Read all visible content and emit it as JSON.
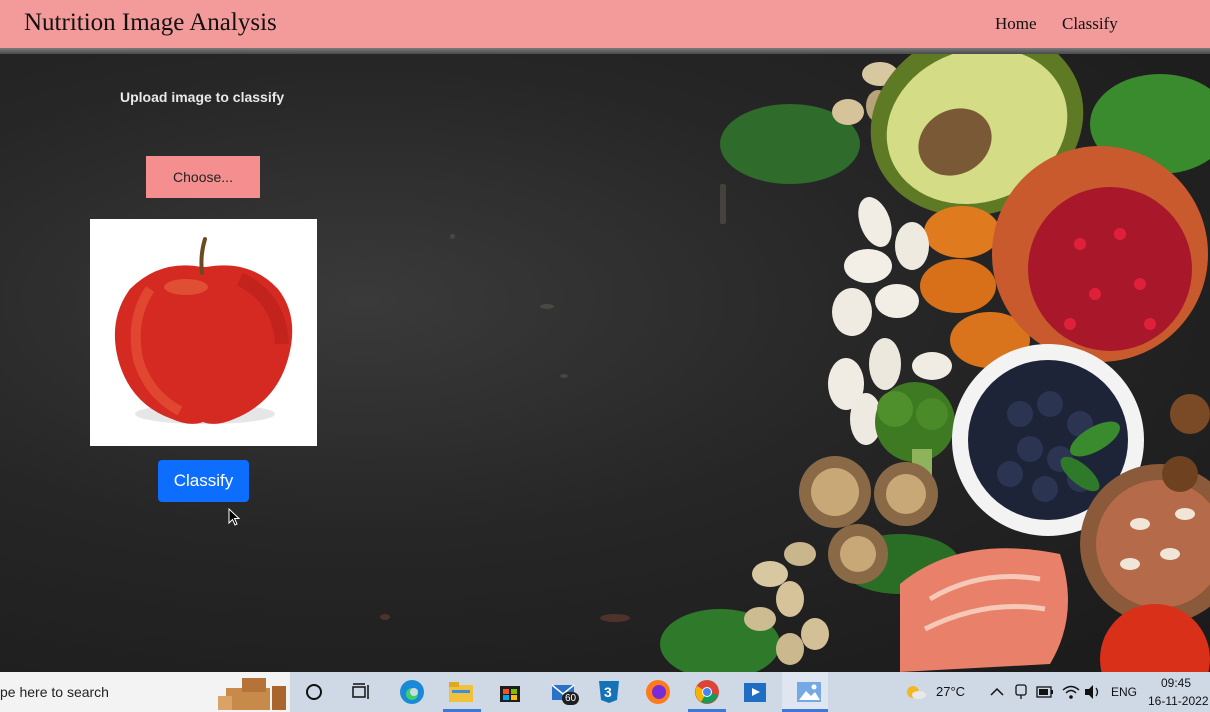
{
  "header": {
    "title": "Nutrition Image Analysis",
    "nav": {
      "home": "Home",
      "classify": "Classify"
    }
  },
  "upload": {
    "title": "Upload image to classify",
    "choose_label": "Choose...",
    "classify_label": "Classify"
  },
  "taskbar": {
    "search_text": "pe here to search",
    "mail_badge": "60",
    "weather_temp": "27°C",
    "language": "ENG",
    "time": "09:45",
    "date": "16-11-2022"
  },
  "colors": {
    "header_bg": "#f39a9a",
    "choose_bg": "#f58f8f",
    "classify_bg": "#0d6efd"
  }
}
